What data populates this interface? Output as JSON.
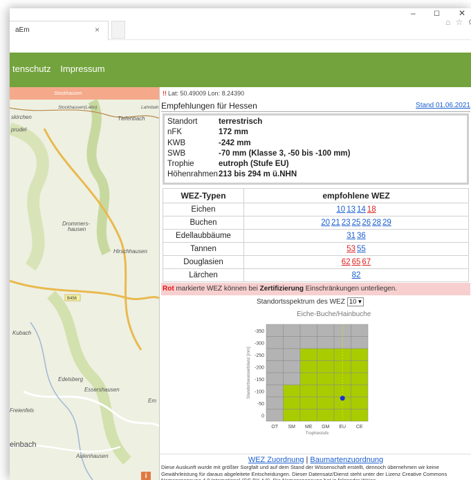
{
  "browser": {
    "tab_title": "aEm",
    "tab_close": "×",
    "win_min": "–",
    "win_max": "◻",
    "win_close": "✕",
    "toolbar_icons": "⌂ ☆ ⚙"
  },
  "nav": {
    "links": [
      "tenschutz",
      "Impressum"
    ]
  },
  "map": {
    "labels": [
      "Stockhausen",
      "Stockhausen(Lahn)",
      "Lahnbah",
      "skirchen",
      "Tiefenbach",
      "prudel",
      "Drommers-",
      "hausen",
      "Hirschhausen",
      "B456",
      "Kubach",
      "Edelsberg",
      "Essershausen",
      "Freienfels",
      "Em",
      "einbach",
      "Aulenhausen"
    ],
    "info_button": "i"
  },
  "panel": {
    "coords_warn": "!!",
    "coords": "Lat: 50.49009 Lon: 8.24390",
    "rec_title": "Empfehlungen für Hessen",
    "rec_date": "Stand 01.06.2021",
    "site": [
      {
        "key": "Standort",
        "val": "terrestrisch"
      },
      {
        "key": "nFK",
        "val": "172 mm"
      },
      {
        "key": "KWB",
        "val": "-242 mm"
      },
      {
        "key": "SWB",
        "val": "-70 mm (Klasse 3, -50 bis -100 mm)"
      },
      {
        "key": "Trophie",
        "val": "eutroph (Stufe EU)"
      },
      {
        "key": "Höhenrahmen",
        "val": "213 bis 294 m ü.NHN"
      }
    ],
    "table_headers": [
      "WEZ-Typen",
      "empfohlene WEZ"
    ],
    "wez_rows": [
      {
        "type": "Eichen",
        "codes": [
          {
            "c": "10",
            "red": false
          },
          {
            "c": "13",
            "red": false
          },
          {
            "c": "14",
            "red": false
          },
          {
            "c": "18",
            "red": true
          }
        ]
      },
      {
        "type": "Buchen",
        "codes": [
          {
            "c": "20",
            "red": false
          },
          {
            "c": "21",
            "red": false
          },
          {
            "c": "23",
            "red": false
          },
          {
            "c": "25",
            "red": false
          },
          {
            "c": "26",
            "red": false
          },
          {
            "c": "28",
            "red": false
          },
          {
            "c": "29",
            "red": false
          }
        ]
      },
      {
        "type": "Edellaubbäume",
        "codes": [
          {
            "c": "31",
            "red": false
          },
          {
            "c": "36",
            "red": false
          }
        ]
      },
      {
        "type": "Tannen",
        "codes": [
          {
            "c": "53",
            "red": true
          },
          {
            "c": "55",
            "red": false
          }
        ]
      },
      {
        "type": "Douglasien",
        "codes": [
          {
            "c": "62",
            "red": true
          },
          {
            "c": "65",
            "red": true
          },
          {
            "c": "67",
            "red": true
          }
        ]
      },
      {
        "type": "Lärchen",
        "codes": [
          {
            "c": "82",
            "red": false
          }
        ]
      }
    ],
    "cert_red": "Rot",
    "cert_mid": " markierte WEZ können bei ",
    "cert_bold": "Zertifizierung",
    "cert_end": " Einschränkungen unterliegen.",
    "spectrum_label": "Standortsspektrum des WEZ",
    "spectrum_select": "10 ▾",
    "chart_title": "Eiche-Buche/Hainbuche",
    "link_zuordnung": "WEZ Zuordnung",
    "link_sep": "|",
    "link_baumarten": "Baumartenzuordnung",
    "disclaimer": "Diese Auskunft wurde mit größter Sorgfalt und auf dem Stand der Wissenschaft erstellt, dennoch übernehmen wir keine Gewährleistung für daraus abgeleitete Entscheidungen. Dieser Datensatz/Dienst steht unter der Lizenz Creative Commons Namensnennung 4.0 International (CC BY 4.0). Die Namensnennung hat in folgender Weise"
  },
  "chart_data": {
    "type": "heatmap",
    "title": "Eiche-Buche/Hainbuche",
    "xlabel": "Trophiestufe",
    "ylabel": "Standortswasserbilanz [mm]",
    "categories": [
      "OT",
      "SM",
      "ME",
      "GM",
      "EU",
      "CE"
    ],
    "ytick_labels": [
      "-350",
      "-300",
      "-250",
      "-200",
      "-150",
      "-100",
      "-50",
      "0"
    ],
    "y_rows": [
      -350,
      -300,
      -250,
      -200,
      -150,
      -100,
      -50,
      0
    ],
    "suitable_cells": {
      "OT": [],
      "SM": [
        -100,
        -50,
        0
      ],
      "ME": [
        -250,
        -200,
        -150,
        -100,
        -50,
        0
      ],
      "GM": [
        -250,
        -200,
        -150,
        -100,
        -50,
        0
      ],
      "EU": [
        -250,
        -200,
        -150,
        -100,
        -50,
        0
      ],
      "CE": [
        -250,
        -200,
        -150,
        -100,
        -50,
        0
      ]
    },
    "point": {
      "x": "EU",
      "y": -70
    },
    "colors": {
      "suitable": "#a8cc00",
      "unsuitable": "#b3b3b3",
      "point": "#1a2fd6"
    }
  }
}
